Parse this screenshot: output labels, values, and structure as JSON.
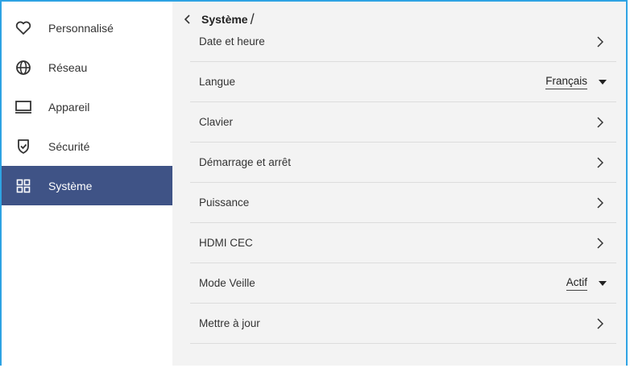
{
  "sidebar": {
    "items": [
      {
        "label": "Personnalisé",
        "icon": "heart-icon"
      },
      {
        "label": "Réseau",
        "icon": "globe-icon"
      },
      {
        "label": "Appareil",
        "icon": "monitor-icon"
      },
      {
        "label": "Sécurité",
        "icon": "shield-check-icon"
      },
      {
        "label": "Système",
        "icon": "grid-icon",
        "active": true
      }
    ]
  },
  "header": {
    "title": "Système",
    "separator": "/"
  },
  "settings": {
    "rows": [
      {
        "label": "Date et heure"
      },
      {
        "label": "Langue",
        "value": "Français"
      },
      {
        "label": "Clavier"
      },
      {
        "label": "Démarrage et arrêt"
      },
      {
        "label": "Puissance"
      },
      {
        "label": "HDMI CEC"
      },
      {
        "label": "Mode Veille",
        "value": "Actif"
      },
      {
        "label": "Mettre à jour"
      }
    ]
  },
  "colors": {
    "accent": "#3f5386",
    "frame": "#2ea3e3",
    "content_bg": "#f3f3f3"
  }
}
